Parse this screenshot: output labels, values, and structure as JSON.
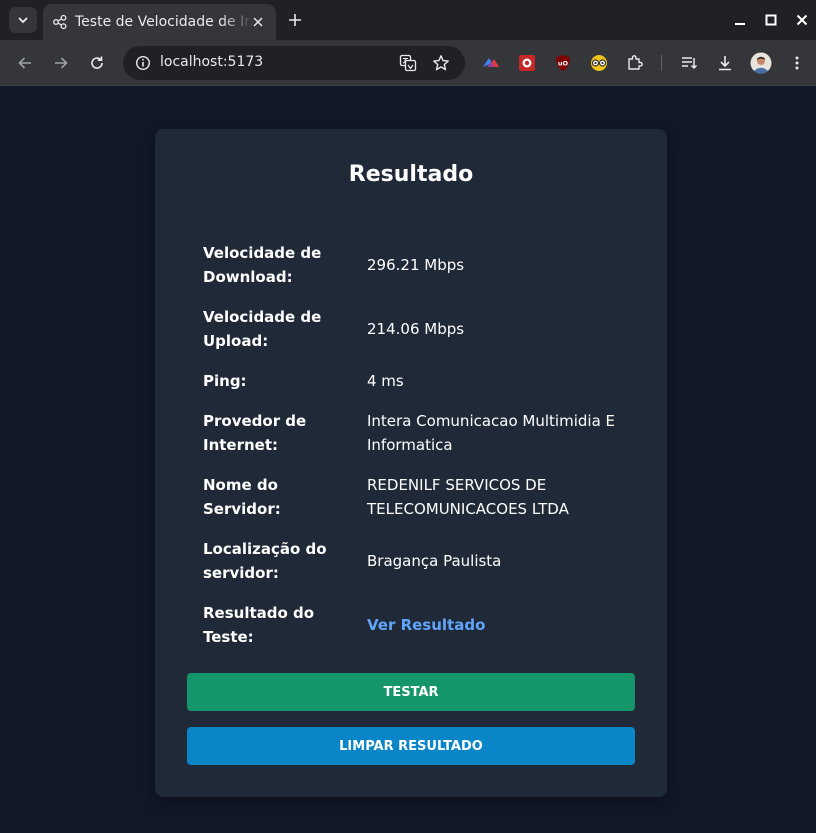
{
  "browser": {
    "tab_title": "Teste de Velocidade de Internet",
    "url": "localhost:5173",
    "icons": {
      "tab_search": "chevron-down-icon",
      "favicon": "share-nodes-icon",
      "tab_close": "close-icon",
      "new_tab": "plus-icon",
      "minimize": "minimize-icon",
      "maximize": "maximize-icon",
      "close_window": "close-window-icon",
      "back": "arrow-back-icon",
      "forward": "arrow-forward-icon",
      "reload": "reload-icon",
      "site_info": "info-icon",
      "translate": "translate-icon",
      "bookmark": "star-icon",
      "extensions": [
        "vpn-extension-icon",
        "red-extension-icon",
        "ublock-icon",
        "glasses-extension-icon",
        "puzzle-icon",
        "reading-list-icon",
        "download-icon",
        "profile-avatar-icon",
        "more-menu-icon"
      ]
    },
    "colors": {
      "tabstrip": "#202124",
      "toolbar": "#35363a",
      "omnibox": "#202124"
    }
  },
  "result": {
    "title": "Resultado",
    "rows": [
      {
        "label": "Velocidade de Download:",
        "value": "296.21 Mbps"
      },
      {
        "label": "Velocidade de Upload:",
        "value": "214.06 Mbps"
      },
      {
        "label": "Ping:",
        "value": "4 ms"
      },
      {
        "label": "Provedor de Internet:",
        "value": "Intera Comunicacao Multimidia E Informatica"
      },
      {
        "label": "Nome do Servidor:",
        "value": "REDENILF SERVICOS DE TELECOMUNICACOES LTDA"
      },
      {
        "label": "Localização do servidor:",
        "value": "Bragança Paulista"
      },
      {
        "label": "Resultado do Teste:",
        "value": "Ver Resultado"
      }
    ],
    "buttons": {
      "test": "TESTAR",
      "clear": "LIMPAR RESULTADO"
    }
  },
  "colors": {
    "page_bg": "#111827",
    "card_bg": "#1f2937",
    "link": "#60a5fa",
    "test_button": "#15956a",
    "clear_button": "#0a86c8"
  }
}
